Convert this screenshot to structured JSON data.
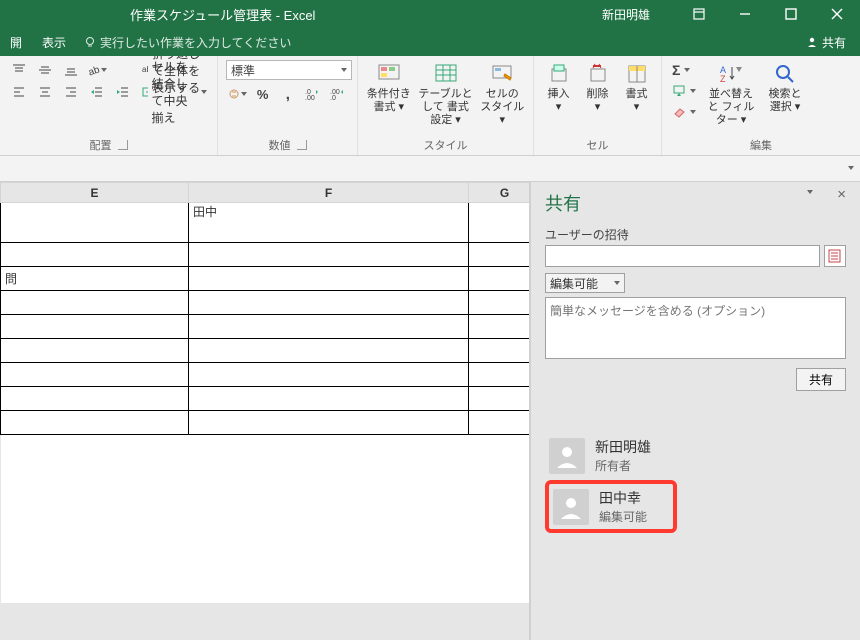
{
  "title": "作業スケジュール管理表 - Excel",
  "user": "新田明雄",
  "menu": {
    "tab1": "開",
    "tab2": "表示",
    "tellme": "実行したい作業を入力してください",
    "share": "共有"
  },
  "ribbon": {
    "alignment": {
      "wrap": "折り返して全体を表示する",
      "merge": "セルを結合して中央揃え",
      "label": "配置"
    },
    "number": {
      "format": "標準",
      "label": "数値"
    },
    "styles": {
      "cond": "条件付き\n書式 ▾",
      "table": "テーブルとして\n書式設定 ▾",
      "cell": "セルの\nスタイル ▾",
      "label": "スタイル"
    },
    "cells": {
      "insert": "挿入",
      "delete": "削除",
      "format": "書式",
      "label": "セル"
    },
    "editing": {
      "sort": "並べ替えと\nフィルター ▾",
      "find": "検索と\n選択 ▾",
      "label": "編集"
    }
  },
  "columns": {
    "e": "E",
    "f": "F",
    "g": "G"
  },
  "cells": {
    "f1": "田中",
    "e3": "問"
  },
  "share": {
    "title": "共有",
    "invite_label": "ユーザーの招待",
    "perm": "編集可能",
    "msg_placeholder": "簡単なメッセージを含める (オプション)",
    "button": "共有",
    "people": [
      {
        "name": "新田明雄",
        "role": "所有者"
      },
      {
        "name": "田中幸",
        "role": "編集可能"
      }
    ]
  }
}
